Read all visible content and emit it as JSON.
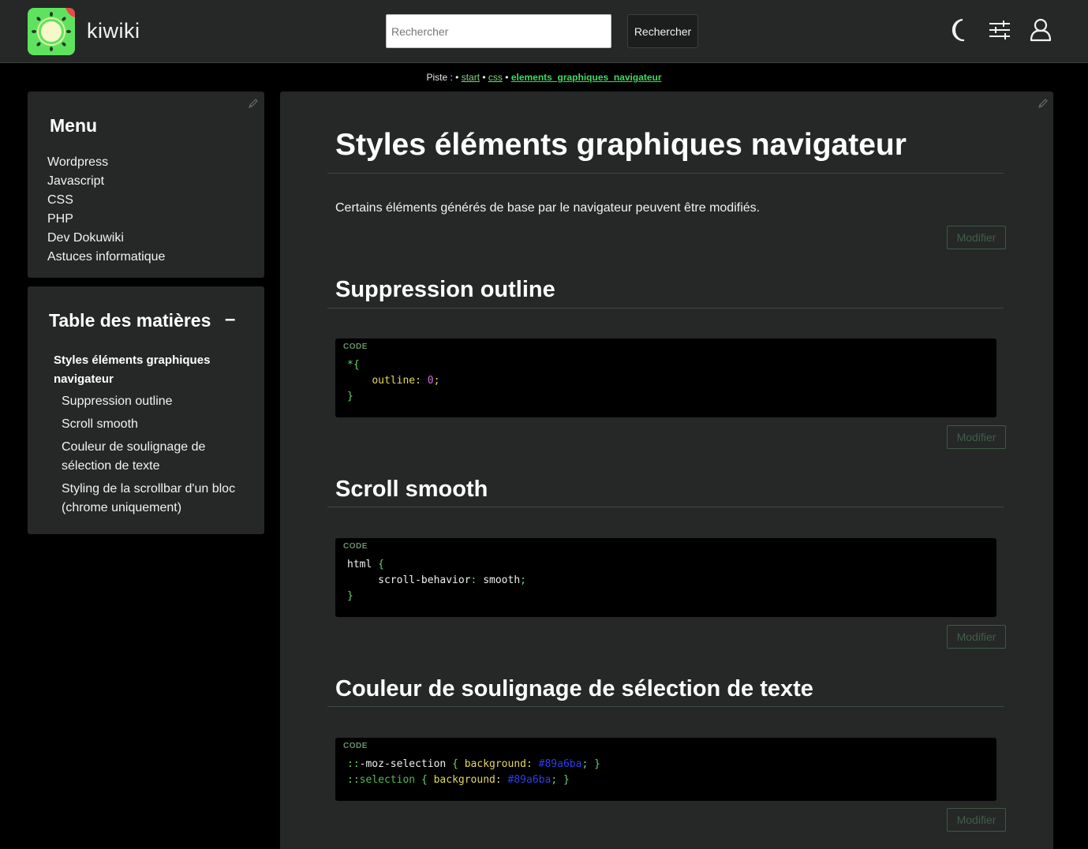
{
  "header": {
    "brand": "kiwiki",
    "search_placeholder": "Rechercher",
    "search_button": "Rechercher"
  },
  "breadcrumb": {
    "label": "Piste :",
    "sep": "•",
    "items": [
      "start",
      "css",
      "elements_graphiques_navigateur"
    ]
  },
  "sidebar": {
    "menu_title": "Menu",
    "menu_items": [
      "Wordpress",
      "Javascript",
      "CSS",
      "PHP",
      "Dev Dokuwiki",
      "Astuces informatique"
    ],
    "toc_title": "Table des matières",
    "toc_toggle": "–",
    "toc_top": "Styles éléments graphiques navigateur",
    "toc_items": [
      "Suppression outline",
      "Scroll smooth",
      "Couleur de soulignage de sélection de texte",
      "Styling de la scrollbar d'un bloc (chrome uniquement)"
    ]
  },
  "main": {
    "title": "Styles éléments graphiques navigateur",
    "intro": "Certains éléments générés de base par le navigateur peuvent être modifiés.",
    "modifier": "Modifier",
    "code_label": "CODE",
    "sections": [
      {
        "title": "Suppression outline",
        "code": [
          [
            [
              "c-sel",
              "*{"
            ]
          ],
          [
            [
              "c-txt",
              "    "
            ],
            [
              "c-prop",
              "outline:"
            ],
            [
              "c-txt",
              " "
            ],
            [
              "c-num",
              "0"
            ],
            [
              "c-prop",
              ";"
            ]
          ],
          [
            [
              "c-br",
              "}"
            ]
          ]
        ]
      },
      {
        "title": "Scroll smooth",
        "code": [
          [
            [
              "c-txt",
              "html"
            ],
            [
              "c-txt",
              " "
            ],
            [
              "c-br",
              "{"
            ]
          ],
          [
            [
              "c-txt",
              "     scroll-behavior"
            ],
            [
              "c-br",
              ":"
            ],
            [
              "c-txt",
              " smooth"
            ],
            [
              "c-br",
              ";"
            ]
          ],
          [
            [
              "c-br",
              "}"
            ]
          ]
        ]
      },
      {
        "title": "Couleur de soulignage de sélection de texte",
        "code": [
          [
            [
              "c-br",
              "::"
            ],
            [
              "c-txt",
              "-moz-selection"
            ],
            [
              "c-txt",
              " "
            ],
            [
              "c-br",
              "{"
            ],
            [
              "c-txt",
              " "
            ],
            [
              "c-prop",
              "background:"
            ],
            [
              "c-txt",
              " "
            ],
            [
              "c-hex",
              "#89a6ba"
            ],
            [
              "c-br",
              ";"
            ],
            [
              "c-txt",
              " "
            ],
            [
              "c-br",
              "}"
            ]
          ],
          [
            [
              "c-br",
              "::"
            ],
            [
              "c-green",
              "selection"
            ],
            [
              "c-txt",
              " "
            ],
            [
              "c-br",
              "{"
            ],
            [
              "c-txt",
              " "
            ],
            [
              "c-prop",
              "background:"
            ],
            [
              "c-txt",
              " "
            ],
            [
              "c-hex",
              "#89a6ba"
            ],
            [
              "c-br",
              ";"
            ],
            [
              "c-txt",
              " "
            ],
            [
              "c-br",
              "}"
            ]
          ]
        ]
      }
    ]
  },
  "colors": {
    "header_bg": "#252826",
    "panel_bg": "#252826",
    "page_bg": "#000000",
    "link": "#7ed87f",
    "logo_green": "#5fe35f"
  },
  "icons": [
    "kiwi-logo-icon",
    "moon-icon",
    "sliders-icon",
    "user-icon",
    "pencil-icon"
  ]
}
